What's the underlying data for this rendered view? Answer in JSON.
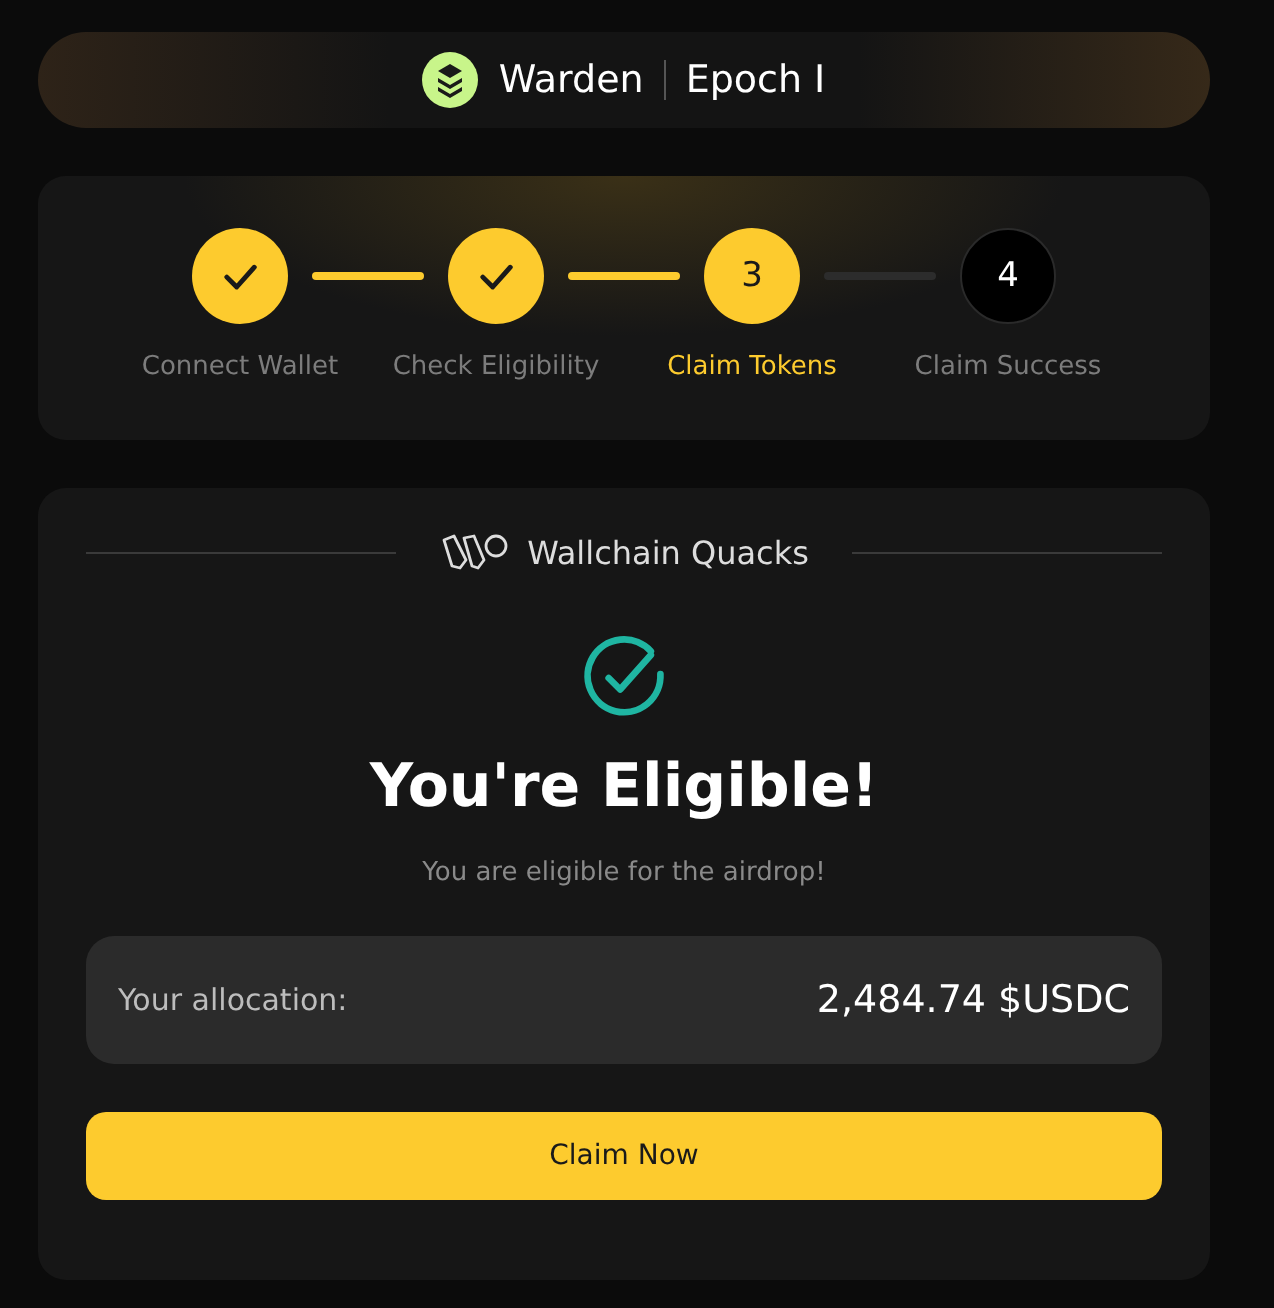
{
  "header": {
    "brand": "Warden",
    "epoch": "Epoch I"
  },
  "steps": [
    {
      "label": "Connect Wallet",
      "kind": "done"
    },
    {
      "label": "Check Eligibility",
      "kind": "done"
    },
    {
      "label": "Claim Tokens",
      "kind": "current",
      "number": "3"
    },
    {
      "label": "Claim Success",
      "kind": "pending",
      "number": "4"
    }
  ],
  "card": {
    "partner": "Wallchain Quacks",
    "title": "You're Eligible!",
    "subtitle": "You are eligible for the airdrop!",
    "allocation_label": "Your allocation:",
    "allocation_value": "2,484.74 $USDC",
    "button": "Claim Now"
  }
}
